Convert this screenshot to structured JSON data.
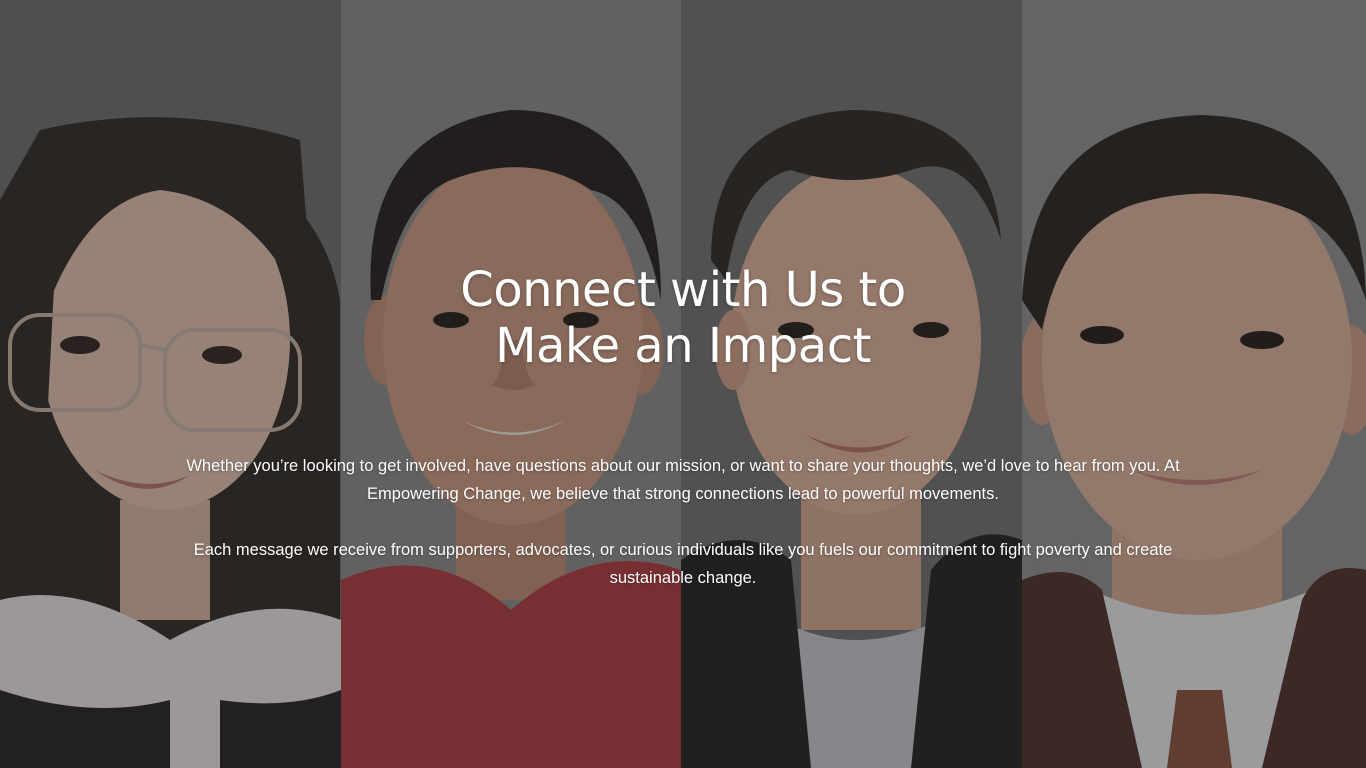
{
  "hero": {
    "headline_line1": "Connect with Us to",
    "headline_line2": "Make an Impact",
    "paragraph1": "Whether you’re looking to get involved, have questions about our mission, or want to share your thoughts, we’d love to hear from you. At Empowering Change, we believe that strong connections lead to powerful movements.",
    "paragraph2": "Each message we receive from supporters, advocates, or curious individuals like you fuels our commitment to fight poverty and create sustainable change.",
    "overlay_color": "#282828"
  },
  "photos": [
    {
      "icon": "portrait-woman-glasses-icon",
      "background": "#6e6e6e"
    },
    {
      "icon": "portrait-man-red-shirt-icon",
      "background": "#8a8a8a"
    },
    {
      "icon": "portrait-man-black-blazer-icon",
      "background": "#7a7a7a"
    },
    {
      "icon": "portrait-man-brown-suit-icon",
      "background": "#8e8e8e"
    }
  ]
}
